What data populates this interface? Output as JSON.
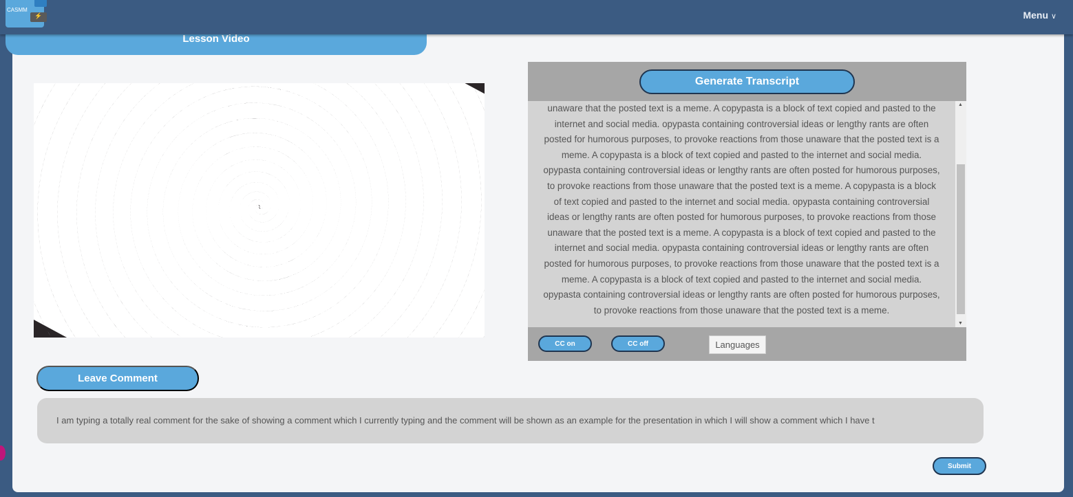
{
  "header": {
    "logo_text": "CASMM",
    "menu_label": "Menu",
    "menu_icon": "chevron-down-icon"
  },
  "lesson": {
    "title": "Lesson Video"
  },
  "transcript": {
    "generate_label": "Generate Transcript",
    "lines": [
      "unaware that the posted text is a meme. A copypasta is a block of text copied and pasted to the",
      "internet and social media. opypasta containing controversial ideas or lengthy rants are often",
      "posted for humorous purposes, to provoke reactions from those unaware that the posted text is a",
      "meme. A copypasta is a block of text copied and pasted to the internet and social media.",
      "opypasta containing controversial ideas or lengthy rants are often posted for humorous purposes,",
      "to provoke reactions from those unaware that the posted text is a meme. A copypasta is a block",
      "of text copied and pasted to the internet and social media. opypasta containing controversial",
      "ideas or lengthy rants are often posted for humorous purposes, to provoke reactions from those",
      "unaware that the posted text is a meme. A copypasta is a block of text copied and pasted to the",
      "internet and social media. opypasta containing controversial ideas or lengthy rants are often",
      "posted for humorous purposes, to provoke reactions from those unaware that the posted text is a",
      "meme. A copypasta is a block of text copied and pasted to the internet and social media.",
      "opypasta containing controversial ideas or lengthy rants are often posted for humorous purposes,",
      "to provoke reactions from those unaware that the posted text is a meme."
    ],
    "cc_on_label": "CC on",
    "cc_off_label": "CC off",
    "languages_label": "Languages"
  },
  "comment": {
    "button_label": "Leave Comment",
    "value": "I am typing a totally real comment for the sake of showing a comment which I currently typing and the comment will be shown as an example for the presentation in which I will show a comment which I have t",
    "submit_label": "Submit"
  },
  "colors": {
    "header": "#3b5b82",
    "accent": "#5aa8dc",
    "panel": "#a6a6a6"
  }
}
